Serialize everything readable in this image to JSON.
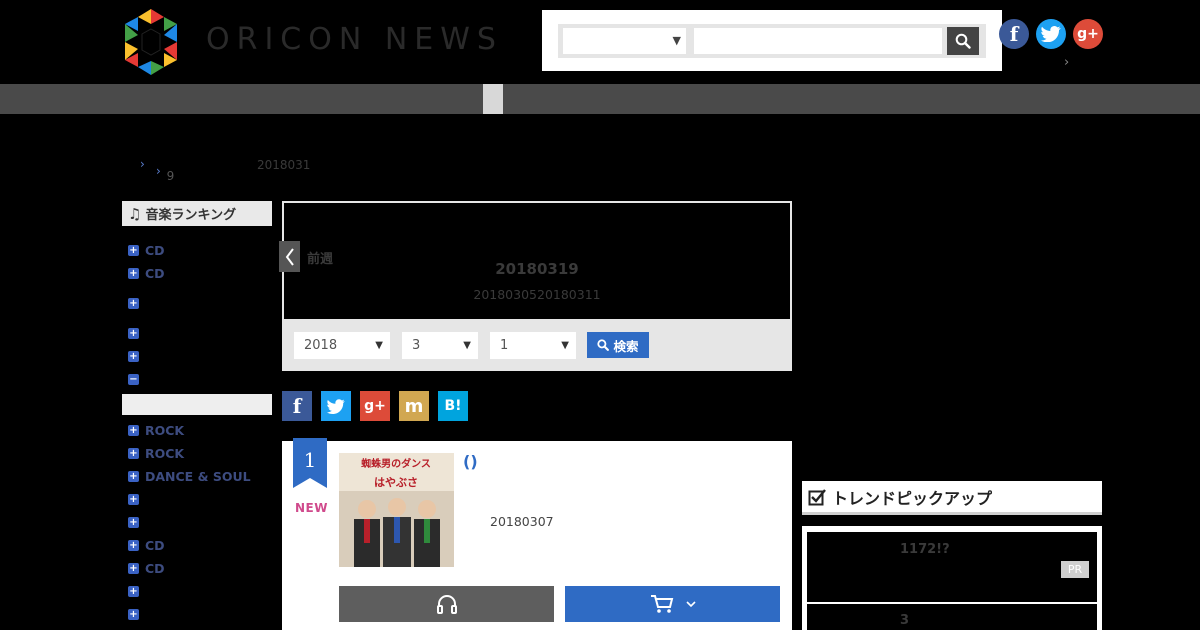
{
  "header": {
    "logo_text": "ORICON NEWS",
    "search": {
      "category_value": "",
      "query_value": "",
      "query_placeholder": ""
    },
    "social": [
      "facebook-icon",
      "twitter-icon",
      "google-plus-icon"
    ]
  },
  "breadcrumb": {
    "level2": "9",
    "date": "2018031"
  },
  "sidebar": {
    "title": "音楽ランキング",
    "items": [
      {
        "label": "CD"
      },
      {
        "label": "CD"
      },
      {
        "label": ""
      },
      {
        "label": ""
      },
      {
        "label": ""
      },
      {
        "label": "",
        "expanded": true
      },
      {
        "label": "ROCK"
      },
      {
        "label": "ROCK"
      },
      {
        "label": "DANCE & SOUL"
      },
      {
        "label": ""
      },
      {
        "label": ""
      },
      {
        "label": "CD"
      },
      {
        "label": "CD"
      },
      {
        "label": ""
      },
      {
        "label": ""
      }
    ]
  },
  "week": {
    "prev_label": "前週",
    "current": "20180319",
    "range": "2018030520180311",
    "year": "2018",
    "month": "3",
    "week_no": "1",
    "search_label": "検索"
  },
  "share": [
    {
      "icon": "facebook-icon",
      "glyph": "f",
      "color": "#3b5998"
    },
    {
      "icon": "twitter-icon",
      "glyph": "t",
      "color": "#1da1f2"
    },
    {
      "icon": "google-plus-icon",
      "glyph": "g+",
      "color": "#dd4b39"
    },
    {
      "icon": "mixi-icon",
      "glyph": "m",
      "color": "#d1a751"
    },
    {
      "icon": "hatena-bookmark-icon",
      "glyph": "B!",
      "color": "#00a4de"
    }
  ],
  "ranking": [
    {
      "rank": "1",
      "badge": "NEW",
      "title": "()",
      "release_date": "20180307",
      "jacket_text": [
        "蜘蛛男のダンス",
        "はやぶさ"
      ]
    }
  ],
  "trend": {
    "title": "トレンドピックアップ",
    "items": [
      {
        "text": "1172!?",
        "pr": "PR"
      },
      {
        "text": "3"
      }
    ]
  },
  "colors": {
    "accent": "#2f6bc4",
    "new_badge": "#d04a8c",
    "nav": "#4a4a4a"
  }
}
